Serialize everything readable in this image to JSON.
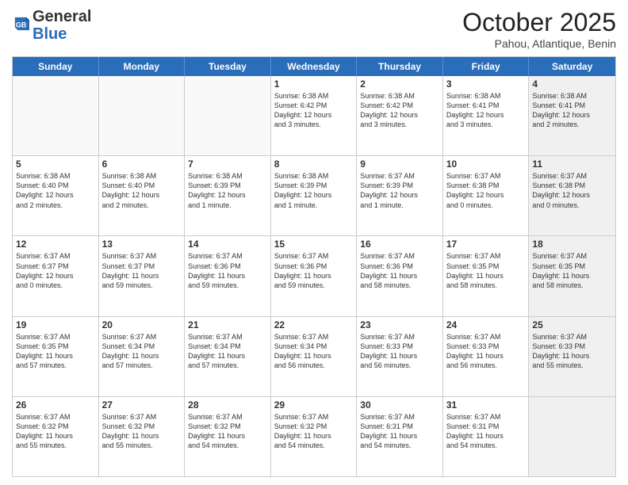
{
  "header": {
    "logo_general": "General",
    "logo_blue": "Blue",
    "month_title": "October 2025",
    "location": "Pahou, Atlantique, Benin"
  },
  "days_of_week": [
    "Sunday",
    "Monday",
    "Tuesday",
    "Wednesday",
    "Thursday",
    "Friday",
    "Saturday"
  ],
  "weeks": [
    [
      {
        "day": "",
        "info": "",
        "shade": "empty"
      },
      {
        "day": "",
        "info": "",
        "shade": "empty"
      },
      {
        "day": "",
        "info": "",
        "shade": "empty"
      },
      {
        "day": "1",
        "info": "Sunrise: 6:38 AM\nSunset: 6:42 PM\nDaylight: 12 hours\nand 3 minutes.",
        "shade": ""
      },
      {
        "day": "2",
        "info": "Sunrise: 6:38 AM\nSunset: 6:42 PM\nDaylight: 12 hours\nand 3 minutes.",
        "shade": ""
      },
      {
        "day": "3",
        "info": "Sunrise: 6:38 AM\nSunset: 6:41 PM\nDaylight: 12 hours\nand 3 minutes.",
        "shade": ""
      },
      {
        "day": "4",
        "info": "Sunrise: 6:38 AM\nSunset: 6:41 PM\nDaylight: 12 hours\nand 2 minutes.",
        "shade": "shaded"
      }
    ],
    [
      {
        "day": "5",
        "info": "Sunrise: 6:38 AM\nSunset: 6:40 PM\nDaylight: 12 hours\nand 2 minutes.",
        "shade": ""
      },
      {
        "day": "6",
        "info": "Sunrise: 6:38 AM\nSunset: 6:40 PM\nDaylight: 12 hours\nand 2 minutes.",
        "shade": ""
      },
      {
        "day": "7",
        "info": "Sunrise: 6:38 AM\nSunset: 6:39 PM\nDaylight: 12 hours\nand 1 minute.",
        "shade": ""
      },
      {
        "day": "8",
        "info": "Sunrise: 6:38 AM\nSunset: 6:39 PM\nDaylight: 12 hours\nand 1 minute.",
        "shade": ""
      },
      {
        "day": "9",
        "info": "Sunrise: 6:37 AM\nSunset: 6:39 PM\nDaylight: 12 hours\nand 1 minute.",
        "shade": ""
      },
      {
        "day": "10",
        "info": "Sunrise: 6:37 AM\nSunset: 6:38 PM\nDaylight: 12 hours\nand 0 minutes.",
        "shade": ""
      },
      {
        "day": "11",
        "info": "Sunrise: 6:37 AM\nSunset: 6:38 PM\nDaylight: 12 hours\nand 0 minutes.",
        "shade": "shaded"
      }
    ],
    [
      {
        "day": "12",
        "info": "Sunrise: 6:37 AM\nSunset: 6:37 PM\nDaylight: 12 hours\nand 0 minutes.",
        "shade": ""
      },
      {
        "day": "13",
        "info": "Sunrise: 6:37 AM\nSunset: 6:37 PM\nDaylight: 11 hours\nand 59 minutes.",
        "shade": ""
      },
      {
        "day": "14",
        "info": "Sunrise: 6:37 AM\nSunset: 6:36 PM\nDaylight: 11 hours\nand 59 minutes.",
        "shade": ""
      },
      {
        "day": "15",
        "info": "Sunrise: 6:37 AM\nSunset: 6:36 PM\nDaylight: 11 hours\nand 59 minutes.",
        "shade": ""
      },
      {
        "day": "16",
        "info": "Sunrise: 6:37 AM\nSunset: 6:36 PM\nDaylight: 11 hours\nand 58 minutes.",
        "shade": ""
      },
      {
        "day": "17",
        "info": "Sunrise: 6:37 AM\nSunset: 6:35 PM\nDaylight: 11 hours\nand 58 minutes.",
        "shade": ""
      },
      {
        "day": "18",
        "info": "Sunrise: 6:37 AM\nSunset: 6:35 PM\nDaylight: 11 hours\nand 58 minutes.",
        "shade": "shaded"
      }
    ],
    [
      {
        "day": "19",
        "info": "Sunrise: 6:37 AM\nSunset: 6:35 PM\nDaylight: 11 hours\nand 57 minutes.",
        "shade": ""
      },
      {
        "day": "20",
        "info": "Sunrise: 6:37 AM\nSunset: 6:34 PM\nDaylight: 11 hours\nand 57 minutes.",
        "shade": ""
      },
      {
        "day": "21",
        "info": "Sunrise: 6:37 AM\nSunset: 6:34 PM\nDaylight: 11 hours\nand 57 minutes.",
        "shade": ""
      },
      {
        "day": "22",
        "info": "Sunrise: 6:37 AM\nSunset: 6:34 PM\nDaylight: 11 hours\nand 56 minutes.",
        "shade": ""
      },
      {
        "day": "23",
        "info": "Sunrise: 6:37 AM\nSunset: 6:33 PM\nDaylight: 11 hours\nand 56 minutes.",
        "shade": ""
      },
      {
        "day": "24",
        "info": "Sunrise: 6:37 AM\nSunset: 6:33 PM\nDaylight: 11 hours\nand 56 minutes.",
        "shade": ""
      },
      {
        "day": "25",
        "info": "Sunrise: 6:37 AM\nSunset: 6:33 PM\nDaylight: 11 hours\nand 55 minutes.",
        "shade": "shaded"
      }
    ],
    [
      {
        "day": "26",
        "info": "Sunrise: 6:37 AM\nSunset: 6:32 PM\nDaylight: 11 hours\nand 55 minutes.",
        "shade": ""
      },
      {
        "day": "27",
        "info": "Sunrise: 6:37 AM\nSunset: 6:32 PM\nDaylight: 11 hours\nand 55 minutes.",
        "shade": ""
      },
      {
        "day": "28",
        "info": "Sunrise: 6:37 AM\nSunset: 6:32 PM\nDaylight: 11 hours\nand 54 minutes.",
        "shade": ""
      },
      {
        "day": "29",
        "info": "Sunrise: 6:37 AM\nSunset: 6:32 PM\nDaylight: 11 hours\nand 54 minutes.",
        "shade": ""
      },
      {
        "day": "30",
        "info": "Sunrise: 6:37 AM\nSunset: 6:31 PM\nDaylight: 11 hours\nand 54 minutes.",
        "shade": ""
      },
      {
        "day": "31",
        "info": "Sunrise: 6:37 AM\nSunset: 6:31 PM\nDaylight: 11 hours\nand 54 minutes.",
        "shade": ""
      },
      {
        "day": "",
        "info": "",
        "shade": "shaded"
      }
    ]
  ]
}
